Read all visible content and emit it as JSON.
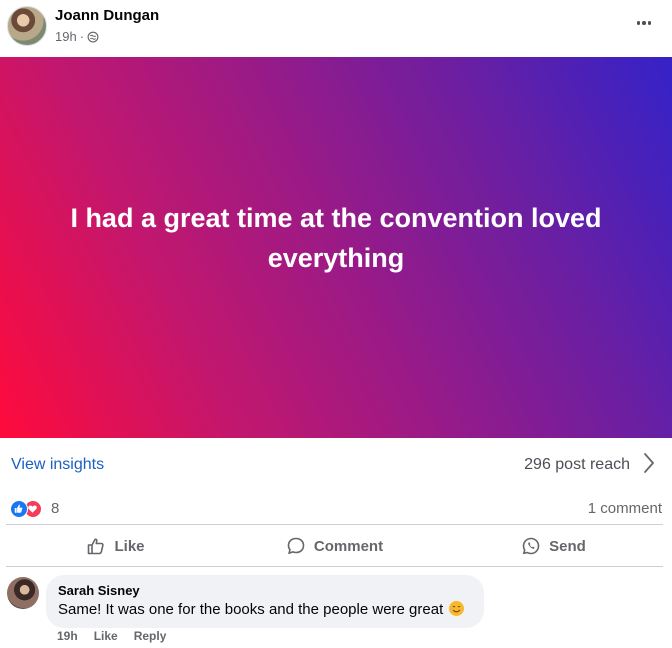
{
  "post": {
    "author": "Joann Dungan",
    "time": "19h",
    "privacy_icon": "globe-icon",
    "more_icon": "more-options-icon",
    "text": "I had a great time at the convention loved everything",
    "background_colors": [
      "#ff0a3c",
      "#9b1a86",
      "#3422c8"
    ]
  },
  "insights": {
    "link_label": "View insights",
    "reach_label": "296 post reach",
    "chevron_icon": "chevron-right-icon"
  },
  "reactions": {
    "icons": [
      "like-reaction-icon",
      "love-reaction-icon"
    ],
    "count": "8",
    "comments_label": "1 comment"
  },
  "actions": {
    "like": "Like",
    "comment": "Comment",
    "send": "Send"
  },
  "comment": {
    "author": "Sarah Sisney",
    "text": "Same! It was one for the books and the people were great",
    "emoji_icon": "smiling-emoji-icon",
    "time": "19h",
    "like_label": "Like",
    "reply_label": "Reply"
  },
  "colors": {
    "link": "#1b5fc1",
    "muted_text": "#65676b",
    "like_blue": "#1877f2",
    "love_red": "#f33e58"
  }
}
